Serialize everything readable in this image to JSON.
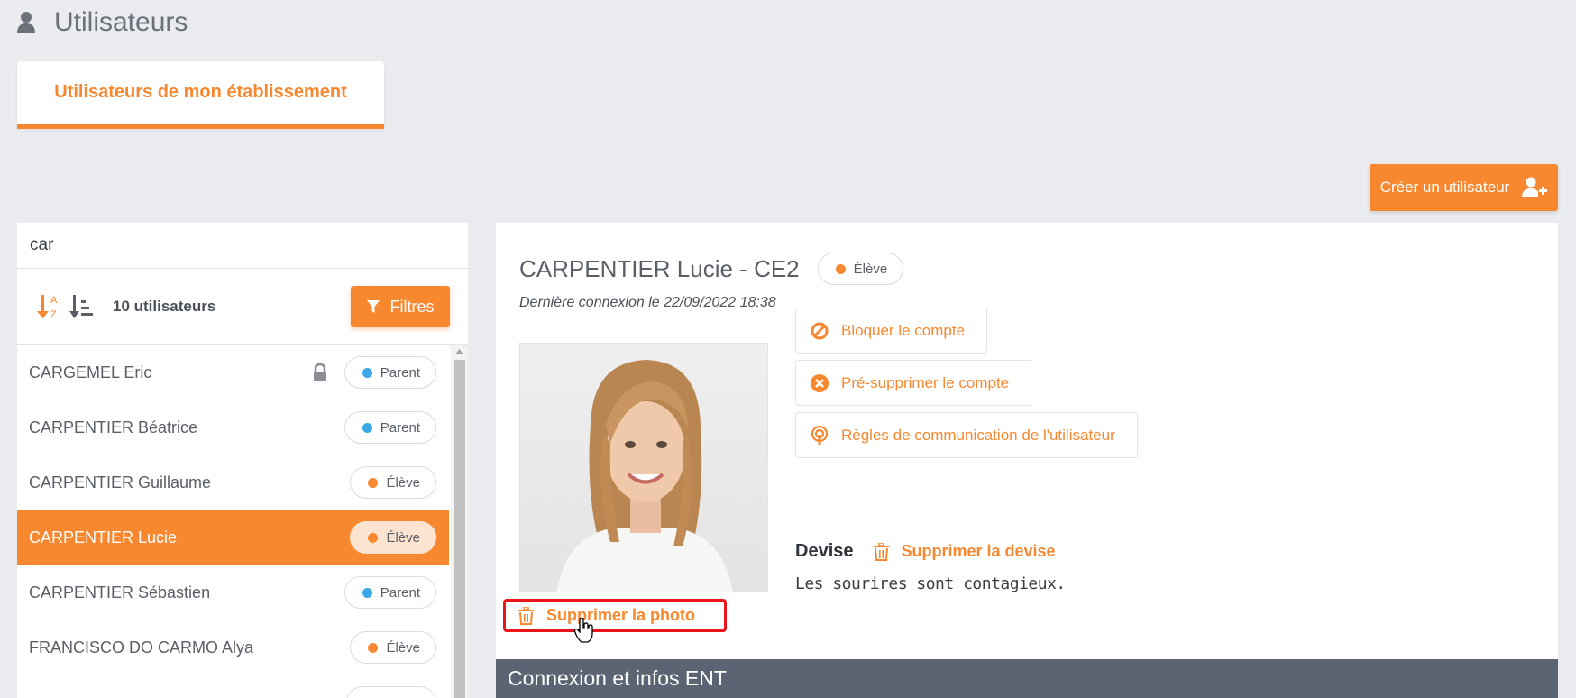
{
  "header": {
    "title": "Utilisateurs",
    "icon": "user-icon"
  },
  "tabs": [
    {
      "label": "Utilisateurs de mon établissement",
      "active": true
    }
  ],
  "create_button": {
    "label": "Créer un utilisateur",
    "icon": "user-plus-icon"
  },
  "search": {
    "value": "car"
  },
  "list_toolbar": {
    "sort_alpha_icon": "sort-alpha-icon",
    "sort_list_icon": "sort-list-icon",
    "count_label": "10 utilisateurs",
    "filter_label": "Filtres",
    "filter_icon": "filter-icon"
  },
  "users": [
    {
      "name": "CARGEMEL Eric",
      "role": "Parent",
      "role_color": "#3aa7e6",
      "locked": true,
      "selected": false
    },
    {
      "name": "CARPENTIER Béatrice",
      "role": "Parent",
      "role_color": "#3aa7e6",
      "locked": false,
      "selected": false
    },
    {
      "name": "CARPENTIER Guillaume",
      "role": "Élève",
      "role_color": "#f7882f",
      "locked": false,
      "selected": false
    },
    {
      "name": "CARPENTIER Lucie",
      "role": "Élève",
      "role_color": "#f7882f",
      "locked": false,
      "selected": true
    },
    {
      "name": "CARPENTIER Sébastien",
      "role": "Parent",
      "role_color": "#3aa7e6",
      "locked": false,
      "selected": false
    },
    {
      "name": "FRANCISCO DO CARMO Alya",
      "role": "Élève",
      "role_color": "#f7882f",
      "locked": false,
      "selected": false
    },
    {
      "name": "",
      "role": "",
      "role_color": "#f7882f",
      "locked": false,
      "selected": false
    }
  ],
  "detail": {
    "name": "CARPENTIER Lucie - CE2",
    "role": "Élève",
    "role_color": "#f7882f",
    "last_login": "Dernière connexion le 22/09/2022 18:38",
    "delete_photo_label": "Supprimer la photo",
    "actions": [
      {
        "label": "Bloquer le compte",
        "icon": "block-icon"
      },
      {
        "label": "Pré-supprimer le compte",
        "icon": "x-circle-icon"
      },
      {
        "label": "Règles de communication de l'utilisateur",
        "icon": "broadcast-icon"
      }
    ],
    "devise": {
      "title": "Devise",
      "delete_label": "Supprimer la devise",
      "text": "Les sourires sont contagieux."
    },
    "section_title": "Connexion et infos ENT"
  },
  "colors": {
    "accent": "#f7882f",
    "parent": "#3aa7e6",
    "highlight": "#e8151b",
    "section_bg": "#5b6472"
  }
}
